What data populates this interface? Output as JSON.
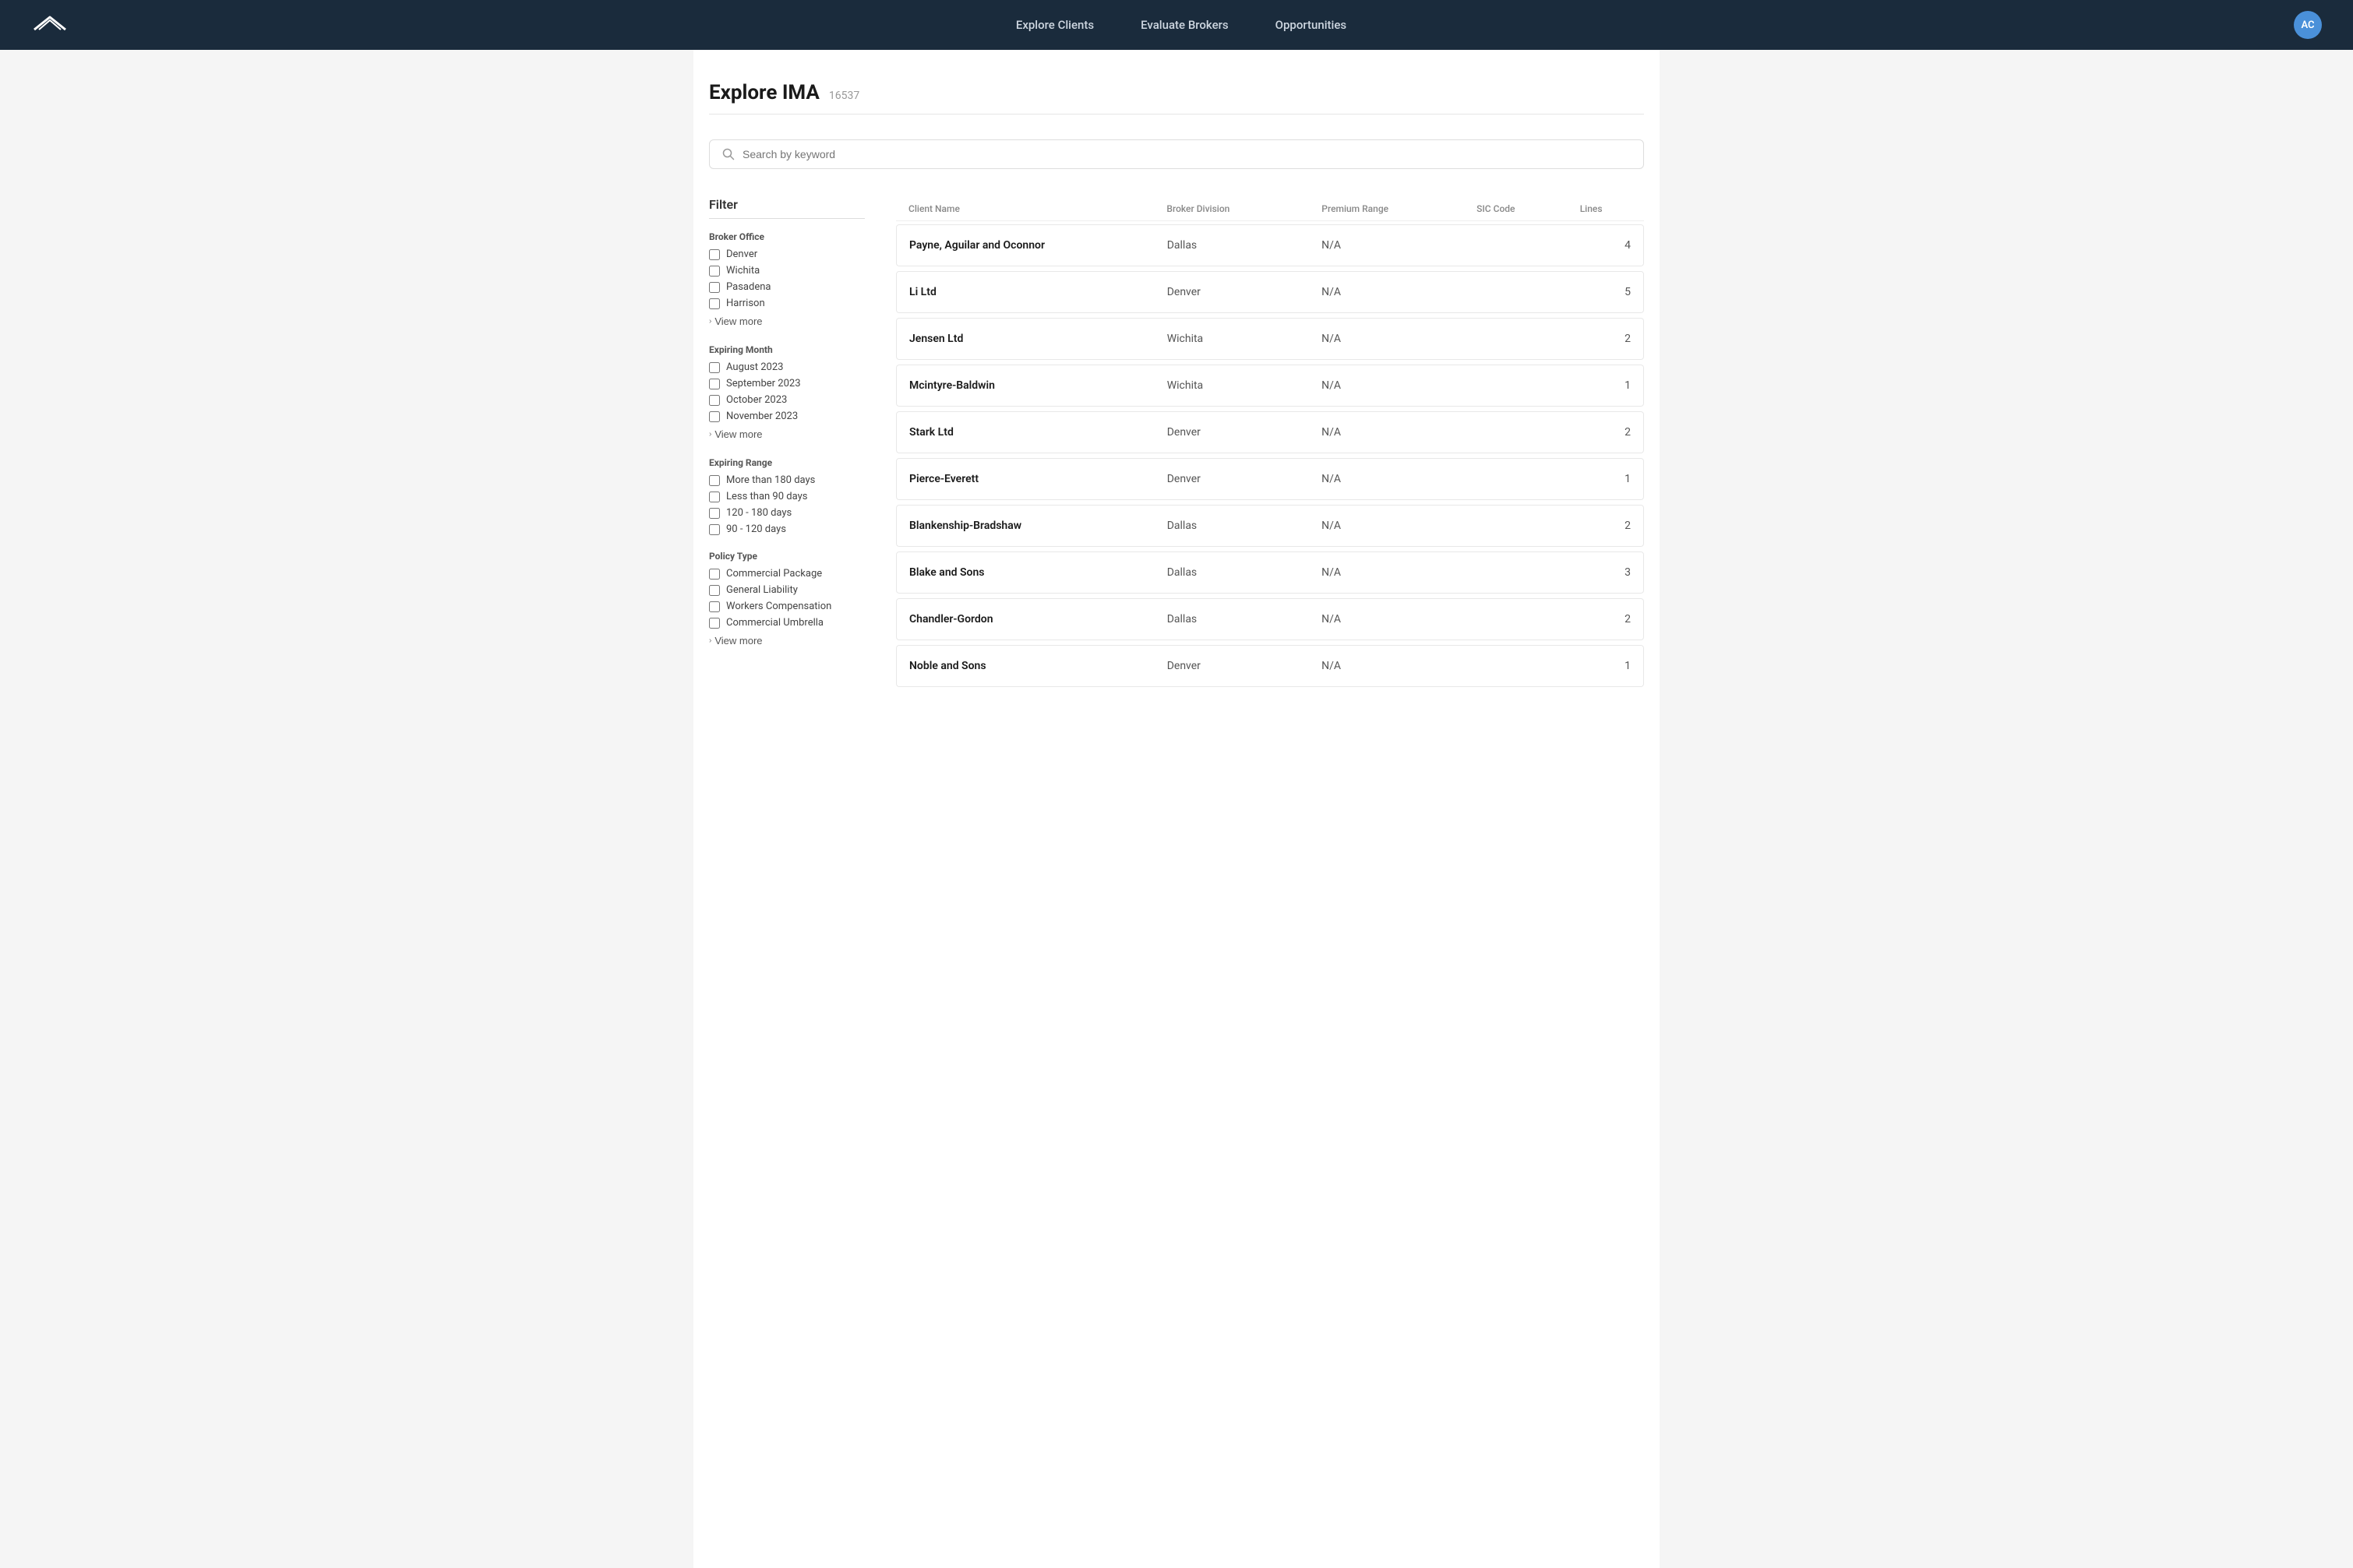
{
  "nav": {
    "logo_alt": "Logo",
    "links": [
      {
        "label": "Explore Clients",
        "id": "explore-clients"
      },
      {
        "label": "Evaluate Brokers",
        "id": "evaluate-brokers"
      },
      {
        "label": "Opportunities",
        "id": "opportunities"
      }
    ],
    "avatar_initials": "AC"
  },
  "page": {
    "title": "Explore IMA",
    "count": "16537"
  },
  "search": {
    "placeholder": "Search by keyword"
  },
  "filter": {
    "title": "Filter",
    "sections": [
      {
        "id": "broker-office",
        "label": "Broker Office",
        "options": [
          {
            "id": "denver",
            "label": "Denver",
            "checked": false
          },
          {
            "id": "wichita",
            "label": "Wichita",
            "checked": false
          },
          {
            "id": "pasadena",
            "label": "Pasadena",
            "checked": false
          },
          {
            "id": "harrison",
            "label": "Harrison",
            "checked": false
          }
        ],
        "view_more": "View more"
      },
      {
        "id": "expiring-month",
        "label": "Expiring Month",
        "options": [
          {
            "id": "august-2023",
            "label": "August 2023",
            "checked": false
          },
          {
            "id": "september-2023",
            "label": "September 2023",
            "checked": false
          },
          {
            "id": "october-2023",
            "label": "October 2023",
            "checked": false
          },
          {
            "id": "november-2023",
            "label": "November 2023",
            "checked": false
          }
        ],
        "view_more": "View more"
      },
      {
        "id": "expiring-range",
        "label": "Expiring Range",
        "options": [
          {
            "id": "more-180",
            "label": "More than 180 days",
            "checked": false
          },
          {
            "id": "less-90",
            "label": "Less than 90 days",
            "checked": false
          },
          {
            "id": "120-180",
            "label": "120 - 180 days",
            "checked": false
          },
          {
            "id": "90-120",
            "label": "90 - 120 days",
            "checked": false
          }
        ],
        "view_more": null
      },
      {
        "id": "policy-type",
        "label": "Policy Type",
        "options": [
          {
            "id": "commercial-package",
            "label": "Commercial Package",
            "checked": false
          },
          {
            "id": "general-liability",
            "label": "General Liability",
            "checked": false
          },
          {
            "id": "workers-compensation",
            "label": "Workers Compensation",
            "checked": false
          },
          {
            "id": "commercial-umbrella",
            "label": "Commercial Umbrella",
            "checked": false
          }
        ],
        "view_more": "View more"
      }
    ]
  },
  "table": {
    "columns": [
      {
        "id": "client-name",
        "label": "Client Name"
      },
      {
        "id": "broker-division",
        "label": "Broker Division"
      },
      {
        "id": "premium-range",
        "label": "Premium Range"
      },
      {
        "id": "sic-code",
        "label": "SIC Code"
      },
      {
        "id": "lines",
        "label": "Lines"
      }
    ],
    "rows": [
      {
        "name": "Payne, Aguilar and Oconnor",
        "broker": "Dallas",
        "premium": "N/A",
        "sic": "",
        "lines": "4"
      },
      {
        "name": "Li Ltd",
        "broker": "Denver",
        "premium": "N/A",
        "sic": "",
        "lines": "5"
      },
      {
        "name": "Jensen Ltd",
        "broker": "Wichita",
        "premium": "N/A",
        "sic": "",
        "lines": "2"
      },
      {
        "name": "Mcintyre-Baldwin",
        "broker": "Wichita",
        "premium": "N/A",
        "sic": "",
        "lines": "1"
      },
      {
        "name": "Stark Ltd",
        "broker": "Denver",
        "premium": "N/A",
        "sic": "",
        "lines": "2"
      },
      {
        "name": "Pierce-Everett",
        "broker": "Denver",
        "premium": "N/A",
        "sic": "",
        "lines": "1"
      },
      {
        "name": "Blankenship-Bradshaw",
        "broker": "Dallas",
        "premium": "N/A",
        "sic": "",
        "lines": "2"
      },
      {
        "name": "Blake and Sons",
        "broker": "Dallas",
        "premium": "N/A",
        "sic": "",
        "lines": "3"
      },
      {
        "name": "Chandler-Gordon",
        "broker": "Dallas",
        "premium": "N/A",
        "sic": "",
        "lines": "2"
      },
      {
        "name": "Noble and Sons",
        "broker": "Denver",
        "premium": "N/A",
        "sic": "",
        "lines": "1"
      }
    ]
  }
}
